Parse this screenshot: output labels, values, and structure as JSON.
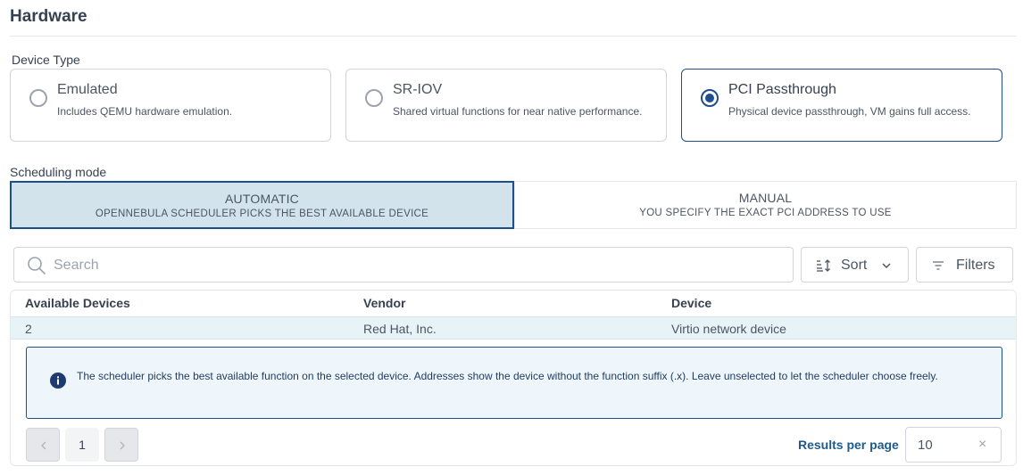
{
  "page": {
    "title": "Hardware"
  },
  "device_type": {
    "label": "Device Type",
    "options": [
      {
        "title": "Emulated",
        "description": "Includes QEMU hardware emulation.",
        "selected": false
      },
      {
        "title": "SR-IOV",
        "description": "Shared virtual functions for near native performance.",
        "selected": false
      },
      {
        "title": "PCI Passthrough",
        "description": "Physical device passthrough, VM gains full access.",
        "selected": true
      }
    ]
  },
  "scheduling": {
    "label": "Scheduling mode",
    "automatic": {
      "title": "AUTOMATIC",
      "subtitle": "OPENNEBULA SCHEDULER PICKS THE BEST AVAILABLE DEVICE",
      "active": true
    },
    "manual": {
      "title": "MANUAL",
      "subtitle": "YOU SPECIFY THE EXACT PCI ADDRESS TO USE",
      "active": false
    }
  },
  "toolbar": {
    "search_placeholder": "Search",
    "sort_label": "Sort",
    "filters_label": "Filters"
  },
  "table": {
    "columns": [
      "Available Devices",
      "Vendor",
      "Device"
    ],
    "rows": [
      {
        "available": "2",
        "vendor": "Red Hat, Inc.",
        "device": "Virtio network device"
      }
    ],
    "info_message": "The scheduler picks the best available function on the selected device. Addresses show the device without the function suffix (.x). Leave unselected to let the scheduler choose freely."
  },
  "pagination": {
    "current_page": "1",
    "results_per_page_label": "Results per page",
    "results_per_page_value": "10",
    "clear_glyph": "×"
  },
  "colors": {
    "accent": "#1e4e8c",
    "selected_row": "#e8f3f7",
    "active_mode_bg": "#d2e3ec",
    "link": "#1e5a8a"
  },
  "icons": [
    "search-icon",
    "sort-icon",
    "chevron-down-icon",
    "filter-icon",
    "info-icon",
    "chevron-left-icon",
    "chevron-right-icon",
    "close-icon"
  ]
}
